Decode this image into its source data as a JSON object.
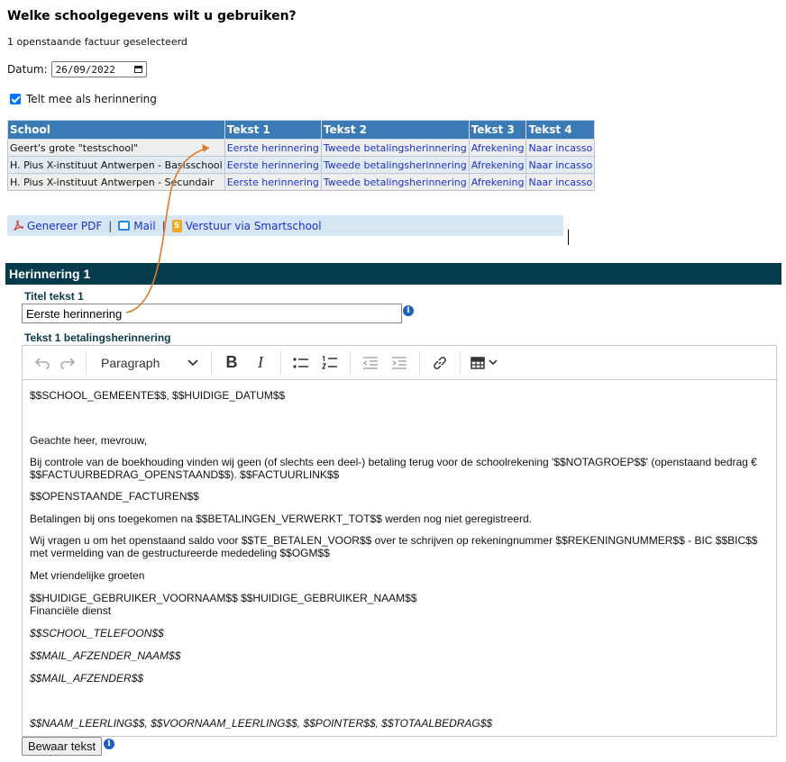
{
  "heading": "Welke schoolgegevens wilt u gebruiken?",
  "subtitle": "1 openstaande factuur geselecteerd",
  "date": {
    "label": "Datum:",
    "value": "26/09/2022"
  },
  "reminder_checkbox": {
    "label": "Telt mee als herinnering",
    "checked": true
  },
  "table": {
    "headers": [
      "School",
      "Tekst 1",
      "Tekst 2",
      "Tekst 3",
      "Tekst 4"
    ],
    "rows": [
      [
        "Geert's grote \"testschool\"",
        "Eerste herinnering",
        "Tweede betalingsherinnering",
        "Afrekening",
        "Naar incasso"
      ],
      [
        "H. Pius X-instituut Antwerpen - Basisschool",
        "Eerste herinnering",
        "Tweede betalingsherinnering",
        "Afrekening",
        "Naar incasso"
      ],
      [
        "H. Pius X-instituut Antwerpen - Secundair",
        "Eerste herinnering",
        "Tweede betalingsherinnering",
        "Afrekening",
        "Naar incasso"
      ]
    ]
  },
  "actions": {
    "pdf": "Genereer PDF",
    "mail": "Mail",
    "smartschool": "Verstuur via Smartschool",
    "separator": "|"
  },
  "section": {
    "title": "Herinnering 1"
  },
  "title_field": {
    "label": "Titel tekst 1",
    "value": "Eerste herinnering"
  },
  "editor": {
    "label": "Tekst 1 betalingsherinnering",
    "toolbar": {
      "paragraph": "Paragraph"
    },
    "lines": {
      "l1": "$$SCHOOL_GEMEENTE$$, $$HUIDIGE_DATUM$$",
      "l2": "Geachte heer, mevrouw,",
      "l3": "Bij controle van de boekhouding vinden wij geen (of slechts een deel-) betaling terug voor de schoolrekening '$$NOTAGROEP$$' (openstaand bedrag € $$FACTUURBEDRAG_OPENSTAAND$$).  $$FACTUURLINK$$",
      "l4": "$$OPENSTAANDE_FACTUREN$$",
      "l5": "Betalingen bij ons toegekomen na $$BETALINGEN_VERWERKT_TOT$$ werden nog niet geregistreerd.",
      "l6": "Wij vragen u om het openstaand saldo voor $$TE_BETALEN_VOOR$$ over te schrijven op rekeningnummer $$REKENINGNUMMER$$ - BIC $$BIC$$ met vermelding van de gestructureerde mededeling $$OGM$$",
      "l7": "Met vriendelijke groeten",
      "l8a": "$$HUIDIGE_GEBRUIKER_VOORNAAM$$ $$HUIDIGE_GEBRUIKER_NAAM$$",
      "l8b": "Financiële dienst",
      "l9": "$$SCHOOL_TELEFOON$$",
      "l10": "$$MAIL_AFZENDER_NAAM$$",
      "l11": "$$MAIL_AFZENDER$$",
      "l12": "$$NAAM_LEERLING$$, $$VOORNAAM_LEERLING$$, $$POINTER$$, $$TOTAALBEDRAG$$"
    }
  },
  "save_button": "Bewaar tekst",
  "colors": {
    "header_bar": "#053c4d",
    "table_header": "#3a7ab5",
    "link": "#1a33c8",
    "arrow": "#e07a28"
  }
}
